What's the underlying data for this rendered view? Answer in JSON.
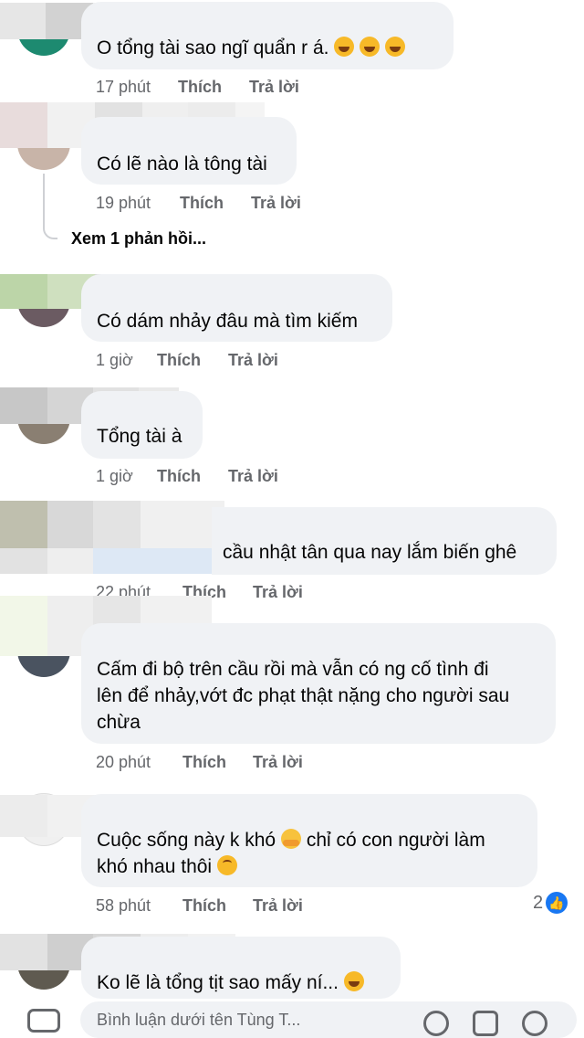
{
  "comments": [
    {
      "text": "O tổng tài sao ngĩ quẩn r á.",
      "time": "17 phút",
      "like": "Thích",
      "reply": "Trả lời"
    },
    {
      "text": "Có lẽ nào là tông tài",
      "time": "19 phút",
      "like": "Thích",
      "reply": "Trả lời",
      "view_replies": "Xem 1 phản hồi..."
    },
    {
      "text": "Có dám nhảy đâu mà tìm kiếm",
      "time": "1 giờ",
      "like": "Thích",
      "reply": "Trả lời"
    },
    {
      "text": "Tổng tài à",
      "time": "1 giờ",
      "like": "Thích",
      "reply": "Trả lời"
    },
    {
      "text": "cầu nhật tân qua nay lắm biến ghê",
      "time": "22 phút",
      "like": "Thích",
      "reply": "Trả lời"
    },
    {
      "line1": "Cấm đi bộ trên cầu rồi mà vẫn có ng cố tình đi",
      "line2": "lên để nhảy,vớt đc phạt thật nặng cho người sau",
      "line3": "chừa",
      "time": "20 phút",
      "like": "Thích",
      "reply": "Trả lời"
    },
    {
      "line1a": "Cuộc sống này k khó",
      "line1b": "chỉ có con người làm",
      "line2": "khó nhau thôi",
      "time": "58 phút",
      "like": "Thích",
      "reply": "Trả lời",
      "reaction_count": "2"
    },
    {
      "text": "Ko lẽ là tổng tịt sao mấy ní...",
      "time": "",
      "like": "",
      "reply": ""
    }
  ],
  "composer": {
    "placeholder": "Bình luận dưới tên Tùng T..."
  },
  "icons": {
    "laugh": "rolling-on-floor-laughing-emoji",
    "hug": "hugging-face-emoji",
    "upside": "upside-down-face-emoji",
    "like": "like-thumb-icon",
    "camera": "camera-icon"
  },
  "colors": {
    "bubble": "#f0f2f5",
    "meta": "#65676b",
    "accent": "#1877f2"
  }
}
